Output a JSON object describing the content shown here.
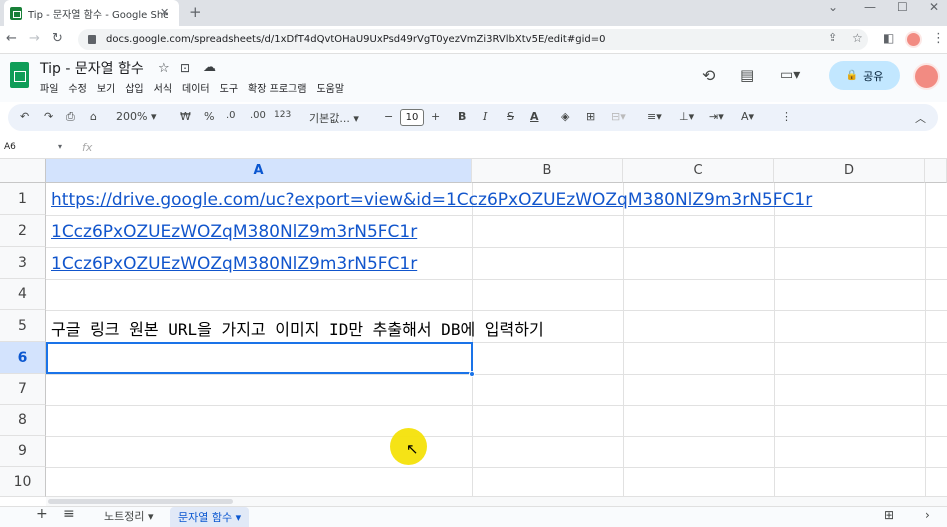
{
  "browser": {
    "tab_title": "Tip - 문자열 함수 - Google Shee",
    "tab_close": "✕",
    "new_tab": "+",
    "win_min": "⌄",
    "win_restore": "—",
    "win_max": "☐",
    "win_close": "✕",
    "url": "docs.google.com/spreadsheets/d/1xDfT4dQvtOHaU9UxPsd49rVgT0yezVmZi3RVlbXtv5E/edit#gid=0"
  },
  "app": {
    "title": "Tip - 문자열 함수",
    "menu": [
      "파일",
      "수정",
      "보기",
      "삽입",
      "서식",
      "데이터",
      "도구",
      "확장 프로그램",
      "도움말"
    ],
    "share_label": "공유"
  },
  "toolbar": {
    "zoom": "200%",
    "currency": "₩",
    "percent": "%",
    "dec_decrease": ".0",
    "dec_increase": ".00",
    "number_format": "123",
    "font": "기본값...",
    "font_size": "10",
    "minus": "−",
    "plus": "+",
    "bold": "B",
    "italic": "I",
    "strike": "S",
    "underline_a": "A"
  },
  "formula_bar": {
    "name_box": "A6",
    "fx": "fx"
  },
  "columns": [
    "A",
    "B",
    "C",
    "D"
  ],
  "rows": [
    "1",
    "2",
    "3",
    "4",
    "5",
    "6",
    "7",
    "8",
    "9",
    "10"
  ],
  "cells": {
    "a1": "https://drive.google.com/uc?export=view&id=1Ccz6PxOZUEzWOZqM380NlZ9m3rN5FC1r",
    "a2": "1Ccz6PxOZUEzWOZqM380NlZ9m3rN5FC1r",
    "a3": "1Ccz6PxOZUEzWOZqM380NlZ9m3rN5FC1r",
    "a5": "구글 링크 원본 URL을 가지고 이미지 ID만 추출해서 DB에 입력하기"
  },
  "sheets": {
    "add": "+",
    "list": "≡",
    "tab1": "노트정리",
    "tab2": "문자열 함수"
  },
  "colors": {
    "accent": "#1a73e8",
    "link": "#1155cc",
    "share_bg": "#c2e7ff",
    "cursor_highlight": "#f4e20a"
  }
}
